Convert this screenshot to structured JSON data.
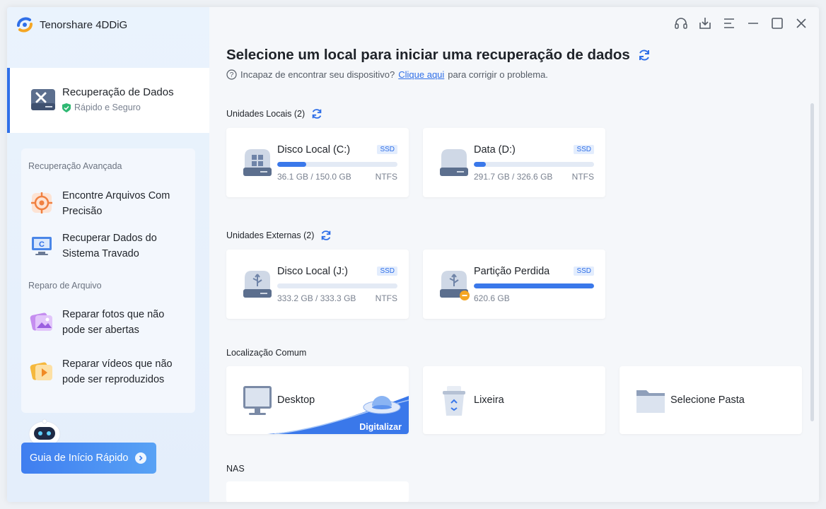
{
  "app": {
    "title": "Tenorshare 4DDiG"
  },
  "sidebar": {
    "active": {
      "label": "Recuperação de Dados",
      "sub": "Rápido e Seguro"
    },
    "advanced_title": "Recuperação Avançada",
    "advanced_items": [
      {
        "label": "Encontre Arquivos Com Precisão",
        "icon": "target-icon"
      },
      {
        "label": "Recuperar Dados do Sistema Travado",
        "icon": "computer-icon"
      }
    ],
    "repair_title": "Reparo de Arquivo",
    "repair_items": [
      {
        "label": "Reparar fotos que não pode ser abertas",
        "icon": "photo-icon"
      },
      {
        "label": "Reparar vídeos que não pode ser reproduzidos",
        "icon": "video-icon"
      }
    ],
    "guide_button": "Guia de Início Rápido"
  },
  "main": {
    "heading": "Selecione um local para iniciar uma recuperação de dados",
    "help_prefix": "Incapaz de encontrar seu dispositivo?",
    "help_link": "Clique aqui",
    "help_suffix": "para corrigir o problema.",
    "local_title": "Unidades Locais (2)",
    "local_drives": [
      {
        "name": "Disco Local (C:)",
        "badge": "SSD",
        "size": "36.1 GB / 150.0 GB",
        "fs": "NTFS",
        "used": 0.24
      },
      {
        "name": "Data (D:)",
        "badge": "SSD",
        "size": "291.7 GB / 326.6 GB",
        "fs": "NTFS",
        "used": 0.1
      }
    ],
    "external_title": "Unidades Externas (2)",
    "external_drives": [
      {
        "name": "Disco Local (J:)",
        "badge": "SSD",
        "size": "333.2 GB / 333.3 GB",
        "fs": "NTFS",
        "used": 0.0
      },
      {
        "name": "Partição Perdida",
        "badge": "SSD",
        "size": "620.6 GB",
        "fs": "",
        "used": 1.0
      }
    ],
    "common_title": "Localização Comum",
    "locations": [
      {
        "name": "Desktop",
        "tag": "Digitalizar"
      },
      {
        "name": "Lixeira"
      },
      {
        "name": "Selecione Pasta"
      }
    ],
    "nas_title": "NAS"
  },
  "colors": {
    "accent": "#2f6fe8",
    "bar_fill": "#3a78ea",
    "bar_track": "#e3eaf5"
  }
}
